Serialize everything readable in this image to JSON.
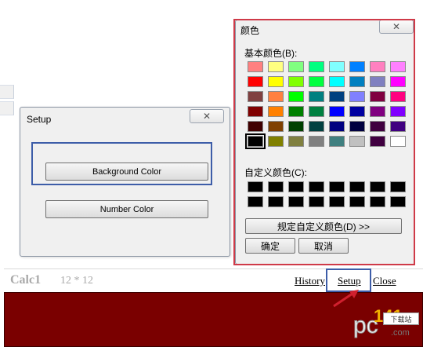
{
  "setup_dialog": {
    "title": "Setup",
    "close_glyph": "✕",
    "background_color_button": "Background Color",
    "number_color_button": "Number Color"
  },
  "color_dialog": {
    "title": "颜色",
    "close_glyph": "✕",
    "basic_colors_label": "基本颜色(B):",
    "custom_colors_label": "自定义颜色(C):",
    "define_custom_button": "规定自定义颜色(D) >>",
    "ok_button": "确定",
    "cancel_button": "取消",
    "basic_colors": [
      [
        "#ff8080",
        "#ffff80",
        "#80ff80",
        "#00ff80",
        "#80ffff",
        "#0080ff",
        "#ff80c0",
        "#ff80ff"
      ],
      [
        "#ff0000",
        "#ffff00",
        "#80ff00",
        "#00ff40",
        "#00ffff",
        "#0080c0",
        "#8080c0",
        "#ff00ff"
      ],
      [
        "#804040",
        "#ff8040",
        "#00ff00",
        "#008080",
        "#004080",
        "#8080ff",
        "#800040",
        "#ff0080"
      ],
      [
        "#800000",
        "#ff8000",
        "#008000",
        "#008040",
        "#0000ff",
        "#0000a0",
        "#800080",
        "#8000ff"
      ],
      [
        "#400000",
        "#804000",
        "#004000",
        "#004040",
        "#000080",
        "#000040",
        "#400040",
        "#400080"
      ],
      [
        "#000000",
        "#808000",
        "#808040",
        "#808080",
        "#408080",
        "#c0c0c0",
        "#400040",
        "#ffffff"
      ]
    ],
    "selected_color": "#000000",
    "custom_colors": [
      "#000000",
      "#000000",
      "#000000",
      "#000000",
      "#000000",
      "#000000",
      "#000000",
      "#000000",
      "#000000",
      "#000000",
      "#000000",
      "#000000",
      "#000000",
      "#000000",
      "#000000",
      "#000000"
    ]
  },
  "calc_bar": {
    "name": "Calc1",
    "expression": "12 * 12",
    "history_link": "History",
    "setup_link": "Setup",
    "close_link": "Close"
  },
  "display": {
    "background_color": "#7a0000"
  },
  "watermark": {
    "brand": "pc",
    "number": "141",
    "tag": "下载站",
    "domain": ".com"
  },
  "colors": {
    "highlight_blue": "#3d5da8",
    "highlight_red": "#cf3a48",
    "arrow_red": "#d0202e"
  }
}
